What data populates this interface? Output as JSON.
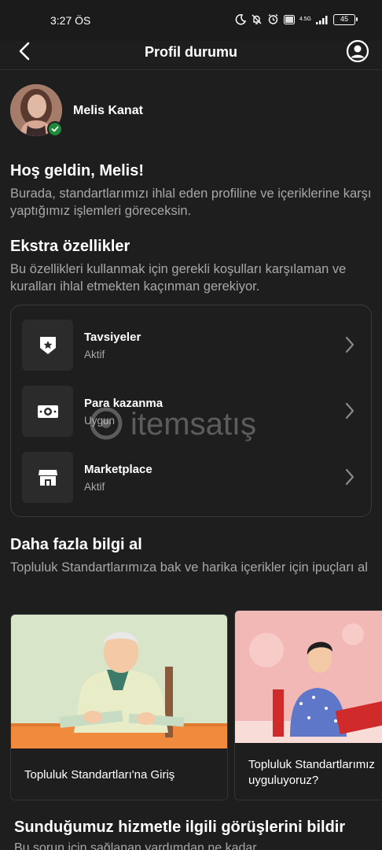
{
  "status_bar": {
    "time": "3:27 ÖS",
    "network": "4.5G",
    "battery": "45"
  },
  "app_bar": {
    "title": "Profil durumu"
  },
  "profile": {
    "name": "Melis Kanat"
  },
  "welcome": {
    "title": "Hoş geldin, Melis!",
    "body": "Burada, standartlarımızı ihlal eden profiline ve içeriklerine karşı yaptığımız işlemleri göreceksin."
  },
  "extras": {
    "title": "Ekstra özellikler",
    "body": "Bu özellikleri kullanmak için gerekli koşulları karşılaman ve kuralları ihlal etmekten kaçınman gerekiyor.",
    "items": [
      {
        "label": "Tavsiyeler",
        "status": "Aktif",
        "icon": "shield-star-icon"
      },
      {
        "label": "Para kazanma",
        "status": "Uygun",
        "icon": "money-icon"
      },
      {
        "label": "Marketplace",
        "status": "Aktif",
        "icon": "storefront-icon"
      }
    ]
  },
  "learn_more": {
    "title": "Daha fazla bilgi al",
    "body": "Topluluk Standartlarımıza bak ve harika içerikler için ipuçları al",
    "cards": [
      {
        "caption": "Topluluk Standartları'na Giriş"
      },
      {
        "caption_line1": "Topluluk Standartlarımız",
        "caption_line2": "uyguluyoruz?"
      }
    ]
  },
  "feedback": {
    "title": "Sunduğumuz hizmetle ilgili görüşlerini bildir",
    "subtitle": "Bu sorun için sağlanan yardımdan ne kadar"
  },
  "watermark": {
    "text": "itemsatış"
  },
  "colors": {
    "background": "#1e1e1e",
    "text_primary": "#ffffff",
    "text_secondary": "#a8a8a8",
    "verified_green": "#1e8a3a",
    "card_border": "#3a3a3a"
  }
}
